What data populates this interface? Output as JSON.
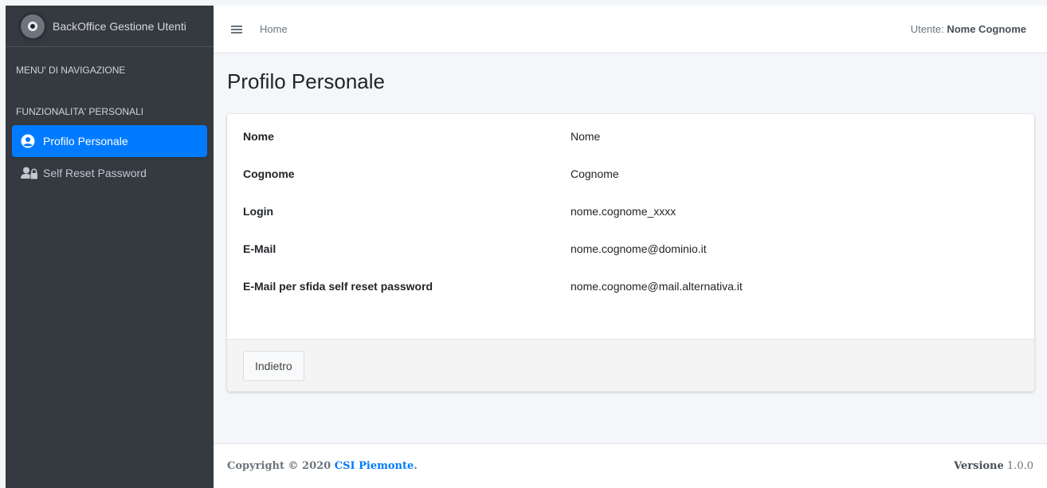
{
  "brand": {
    "title": "BackOffice Gestione Utenti"
  },
  "sidebar": {
    "nav_header": "MENU' DI NAVIGAZIONE",
    "section_header": "FUNZIONALITA' PERSONALI",
    "items": [
      {
        "label": "Profilo Personale",
        "icon": "user-circle-icon",
        "active": true
      },
      {
        "label": "Self Reset Password",
        "icon": "user-lock-icon",
        "active": false
      }
    ]
  },
  "topbar": {
    "home_label": "Home",
    "user_prefix": "Utente:",
    "user_name": "Nome Cognome"
  },
  "page": {
    "title": "Profilo Personale"
  },
  "profile": {
    "rows": [
      {
        "label": "Nome",
        "value": "Nome"
      },
      {
        "label": "Cognome",
        "value": "Cognome"
      },
      {
        "label": "Login",
        "value": "nome.cognome_xxxx"
      },
      {
        "label": "E-Mail",
        "value": "nome.cognome@dominio.it"
      },
      {
        "label": "E-Mail per sfida self reset password",
        "value": "nome.cognome@mail.alternativa.it"
      }
    ],
    "back_button_label": "Indietro"
  },
  "footer": {
    "copyright_prefix": "Copyright © 2020",
    "company": "CSI Piemonte",
    "copyright_suffix": ".",
    "version_label": "Versione",
    "version_value": "1.0.0"
  },
  "colors": {
    "accent": "#007bff",
    "sidebar_bg": "#343a40",
    "content_bg": "#f4f6f9"
  }
}
